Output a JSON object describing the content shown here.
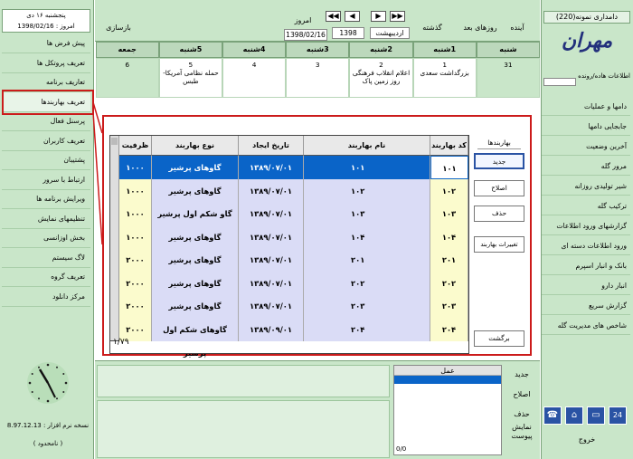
{
  "right_sidebar": {
    "header": "دامداری نمونه(220)",
    "logo": "مهران",
    "info_label": "اطلاعات هاده/رونده",
    "items": [
      "دامها و عملیات",
      "جابجایی دامها",
      "آخرین وضعیت",
      "مرور گله",
      "شیر تولیدی روزانه",
      "ترکیب گله",
      "گزارشهای ورود اطلاعات",
      "ورود اطلاعات دسته ای",
      "بانک و انبار اسپرم",
      "انبار دارو",
      "گزارش سریع",
      "شاخص های مدیریت گله"
    ],
    "icons": [
      "phone-icon",
      "home-icon",
      "monitor-icon",
      "calendar-icon"
    ],
    "icon_glyphs": [
      "☎",
      "⌂",
      "▭",
      "24"
    ],
    "exit": "خروج"
  },
  "left_sidebar": {
    "today_line1": "پنجشنبه ۱۶ دی",
    "today_line2": "امروز : 1398/02/16",
    "items": [
      "پیش فرض ها",
      "تعریف پروتکل ها",
      "تعاریف برنامه",
      "تعریف بهاربندها",
      "پرسنل فعال",
      "تعریف کاربران",
      "پشتیبان",
      "ارتباط با سرور",
      "ویرایش برنامه ها",
      "تنظیمهای نمایش",
      "بخش اوزانسی",
      "لاگ سیستم",
      "تعریف گروه",
      "مرکز دانلود"
    ],
    "highlighted_index": 3,
    "version": "نسخه نرم افزار : 8.97.12.13",
    "unnamed": "( نامحدود )"
  },
  "topbar": {
    "refresh": "بازسازی",
    "today_label": "امروز",
    "today_date": "1398/02/16",
    "year": "1398",
    "month": "اردیبهشت",
    "next_days": "روزهای بعد",
    "past": "گذشته",
    "future": "آینده",
    "nav_first": "◀◀",
    "nav_prev": "◀",
    "nav_next": "▶",
    "nav_last": "▶▶"
  },
  "calendar": {
    "days": [
      "شنبه",
      "1شنبه",
      "2شنبه",
      "3شنبه",
      "4شنبه",
      "5شنبه",
      "جمعه"
    ],
    "cells": [
      {
        "num": "31",
        "text": ""
      },
      {
        "num": "1",
        "text": "بزرگداشت سعدی"
      },
      {
        "num": "2",
        "text": "اعلام انقلاب فرهنگی روز زمین پاک"
      },
      {
        "num": "3",
        "text": ""
      },
      {
        "num": "4",
        "text": ""
      },
      {
        "num": "5",
        "text": "حمله نظامی آمریکا-طبس"
      },
      {
        "num": "6",
        "text": ""
      }
    ]
  },
  "modal": {
    "tab": "بهاربندها",
    "columns": [
      "کد بهاربند",
      "نام بهاربند",
      "تاریخ ایجاد",
      "نوع بهاربند",
      "ظرفیت"
    ],
    "rows": [
      {
        "code": "۱۰۱",
        "name": "۱۰۱",
        "date": "۱۳۸۹/۰۷/۰۱",
        "type": "گاوهای پرشیر",
        "cap": "۱۰۰۰"
      },
      {
        "code": "۱۰۲",
        "name": "۱۰۲",
        "date": "۱۳۸۹/۰۷/۰۱",
        "type": "گاوهای پرشیر",
        "cap": "۱۰۰۰"
      },
      {
        "code": "۱۰۳",
        "name": "۱۰۳",
        "date": "۱۳۸۹/۰۷/۰۱",
        "type": "گاو شکم اول پرشیر",
        "cap": "۱۰۰۰"
      },
      {
        "code": "۱۰۴",
        "name": "۱۰۴",
        "date": "۱۳۸۹/۰۷/۰۱",
        "type": "گاوهای پرشیر",
        "cap": "۱۰۰۰"
      },
      {
        "code": "۲۰۱",
        "name": "۲۰۱",
        "date": "۱۳۸۹/۰۷/۰۱",
        "type": "گاوهای پرشیر",
        "cap": "۲۰۰۰"
      },
      {
        "code": "۲۰۲",
        "name": "۲۰۲",
        "date": "۱۳۸۹/۰۷/۰۱",
        "type": "گاوهای پرشیر",
        "cap": "۲۰۰۰"
      },
      {
        "code": "۲۰۳",
        "name": "۲۰۳",
        "date": "۱۳۸۹/۰۷/۰۱",
        "type": "گاوهای پرشیر",
        "cap": "۲۰۰۰"
      },
      {
        "code": "۲۰۴",
        "name": "۲۰۴",
        "date": "۱۳۸۹/۰۹/۰۱",
        "type": "گاوهای شکم اول پرشیر",
        "cap": "۲۰۰۰"
      }
    ],
    "count": "۱/۷۹",
    "buttons": {
      "new": "جدید",
      "edit": "اصلاح",
      "delete": "حذف",
      "change": "تغییرات بهاربند",
      "back": "برگشت"
    }
  },
  "bottom": {
    "header": "عمل",
    "new": "جدید",
    "edit": "اصلاح",
    "delete": "حذف",
    "show_attach": "نمایش پیوست",
    "count": "0/0"
  },
  "colors": {
    "panel": "#c9e6c9",
    "highlight_border": "#cc1b1b",
    "selected_row": "#0a64c8",
    "row_fill": "#dadcf6",
    "code_fill": "#fbfbcd"
  }
}
